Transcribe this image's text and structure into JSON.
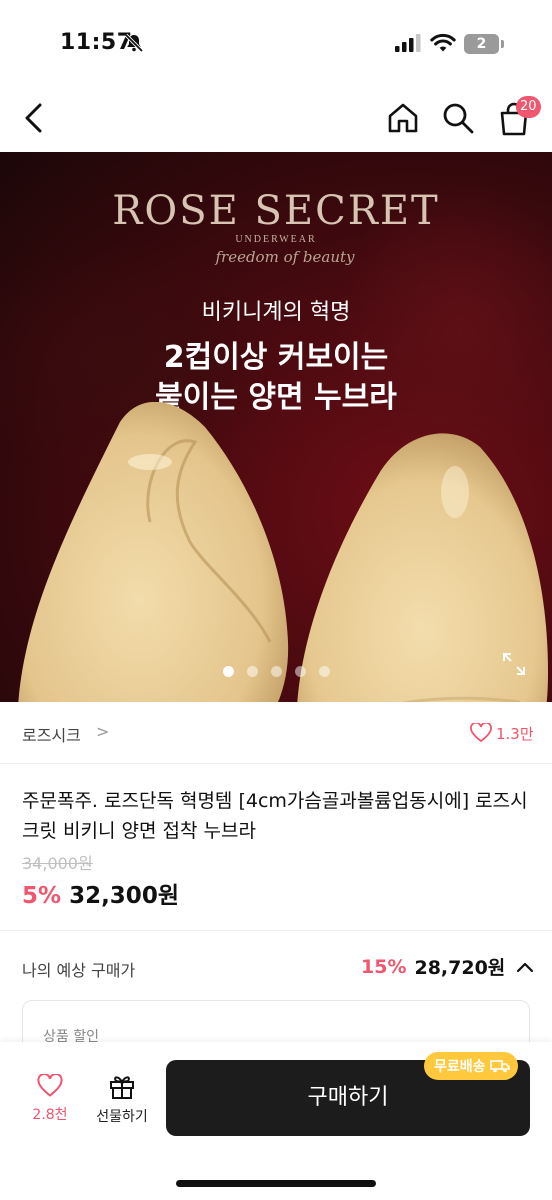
{
  "status_bar": {
    "time": "11:57",
    "battery": "2"
  },
  "nav": {
    "cart_count": "20"
  },
  "hero": {
    "brand": "ROSE SECRET",
    "brand_sub": "UNDERWEAR",
    "brand_script": "freedom of beauty",
    "line1": "비키니계의 혁명",
    "line2": "2컵이상 커보이는",
    "line3": "붙이는 양면 누브라",
    "slide_count": 5,
    "active_slide": 1
  },
  "store": {
    "name": "로즈시크",
    "chevron": ">",
    "likes": "1.3만"
  },
  "product": {
    "title": "주문폭주. 로즈단독 혁명템 [4cm가슴골과볼륨업동시에] 로즈시크릿 비키니 양면 접착 누브라",
    "original_price": "34,000원",
    "discount": "5%",
    "price": "32,300원"
  },
  "estimate": {
    "label": "나의 예상 구매가",
    "discount": "15%",
    "price": "28,720원",
    "card_label": "상품 할인"
  },
  "bottom": {
    "favorites": "2.8천",
    "gift_label": "선물하기",
    "buy_label": "구매하기",
    "free_shipping": "무료배송"
  },
  "colors": {
    "accent": "#f0566e",
    "buy_button": "#1c1c1c",
    "free_shipping_badge": "#ffc83d"
  }
}
